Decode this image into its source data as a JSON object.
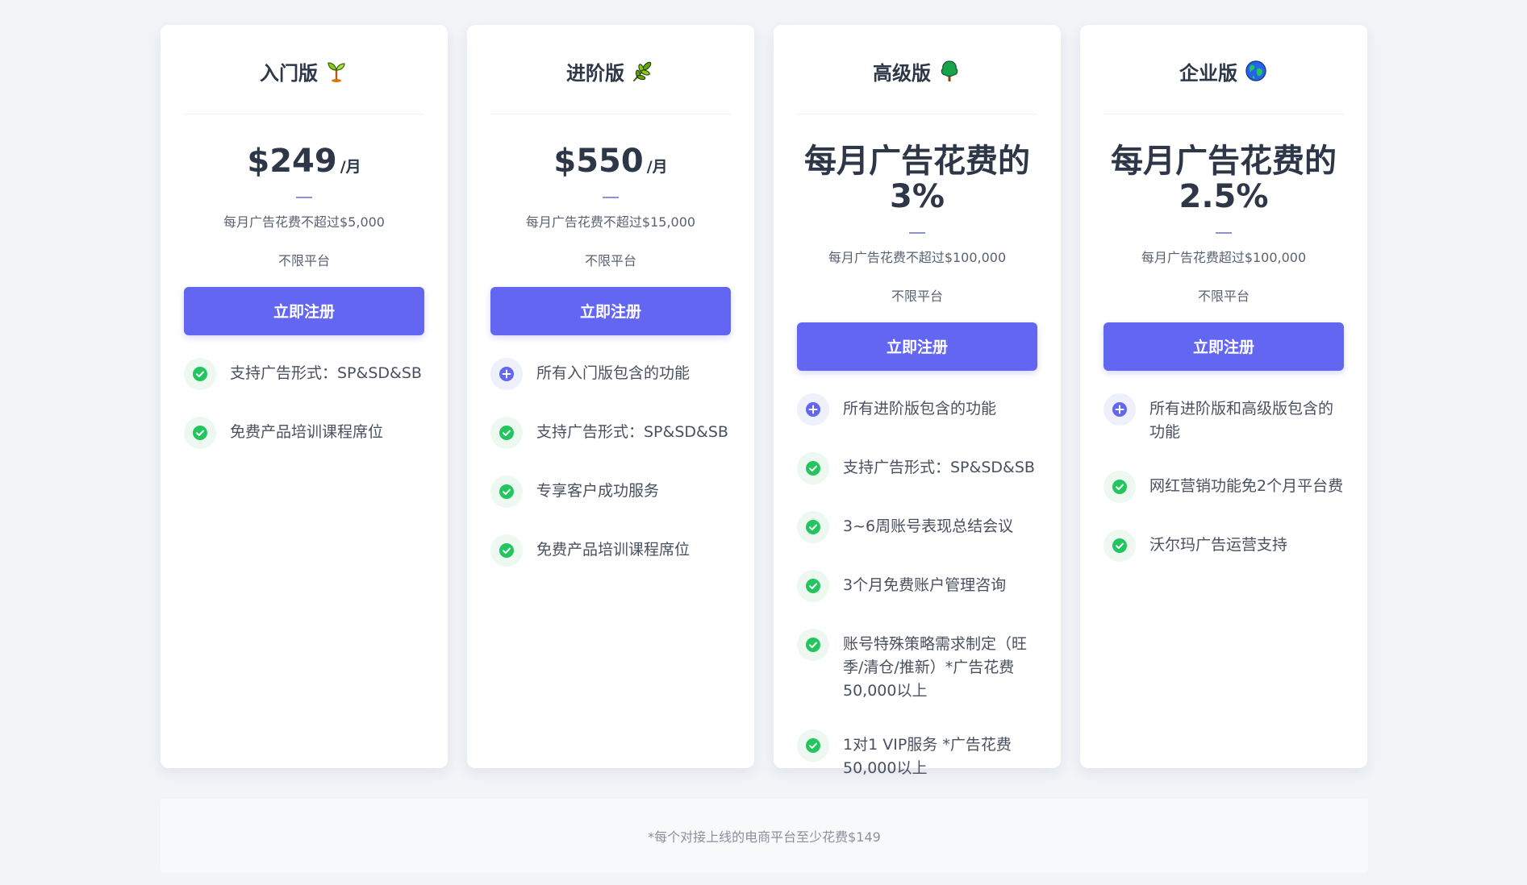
{
  "plans": [
    {
      "name": "入门版",
      "icon": "sprout-icon",
      "price_amount": "$249",
      "price_period": "/月",
      "cap": "每月广告花费不超过$5,000",
      "platform": "不限平台",
      "cta": "立即注册",
      "features": [
        {
          "icon": "check-circle-icon",
          "text": "支持广告形式：SP&SD&SB"
        },
        {
          "icon": "check-circle-icon",
          "text": "免费产品培训课程席位"
        }
      ]
    },
    {
      "name": "进阶版",
      "icon": "herb-icon",
      "price_amount": "$550",
      "price_period": "/月",
      "cap": "每月广告花费不超过$15,000",
      "platform": "不限平台",
      "cta": "立即注册",
      "features": [
        {
          "icon": "plus-circle-icon",
          "text": "所有入门版包含的功能"
        },
        {
          "icon": "check-circle-icon",
          "text": "支持广告形式：SP&SD&SB"
        },
        {
          "icon": "check-circle-icon",
          "text": "专享客户成功服务"
        },
        {
          "icon": "check-circle-icon",
          "text": "免费产品培训课程席位"
        }
      ]
    },
    {
      "name": "高级版",
      "icon": "tree-icon",
      "price_text": "每月广告花费的3%",
      "cap": "每月广告花费不超过$100,000",
      "platform": "不限平台",
      "cta": "立即注册",
      "features": [
        {
          "icon": "plus-circle-icon",
          "text": "所有进阶版包含的功能"
        },
        {
          "icon": "check-circle-icon",
          "text": "支持广告形式：SP&SD&SB"
        },
        {
          "icon": "check-circle-icon",
          "text": "3~6周账号表现总结会议"
        },
        {
          "icon": "check-circle-icon",
          "text": "3个月免费账户管理咨询"
        },
        {
          "icon": "check-circle-icon",
          "text": "账号特殊策略需求制定（旺季/清仓/推新）*广告花费50,000以上"
        },
        {
          "icon": "check-circle-icon",
          "text": "1对1 VIP服务 *广告花费50,000以上"
        }
      ]
    },
    {
      "name": "企业版",
      "icon": "globe-icon",
      "price_text": "每月广告花费的2.5%",
      "cap": "每月广告花费超过$100,000",
      "platform": "不限平台",
      "cta": "立即注册",
      "features": [
        {
          "icon": "plus-circle-icon",
          "text": "所有进阶版和高级版包含的功能"
        },
        {
          "icon": "check-circle-icon",
          "text": "网红营销功能免2个月平台费"
        },
        {
          "icon": "check-circle-icon",
          "text": "沃尔玛广告运营支持"
        }
      ]
    }
  ],
  "footer_note": "*每个对接上线的电商平台至少花费$149",
  "colors": {
    "accent": "#6366f1",
    "check": "#22c55e",
    "plus": "#6366f1",
    "background": "#f2f4f8"
  }
}
